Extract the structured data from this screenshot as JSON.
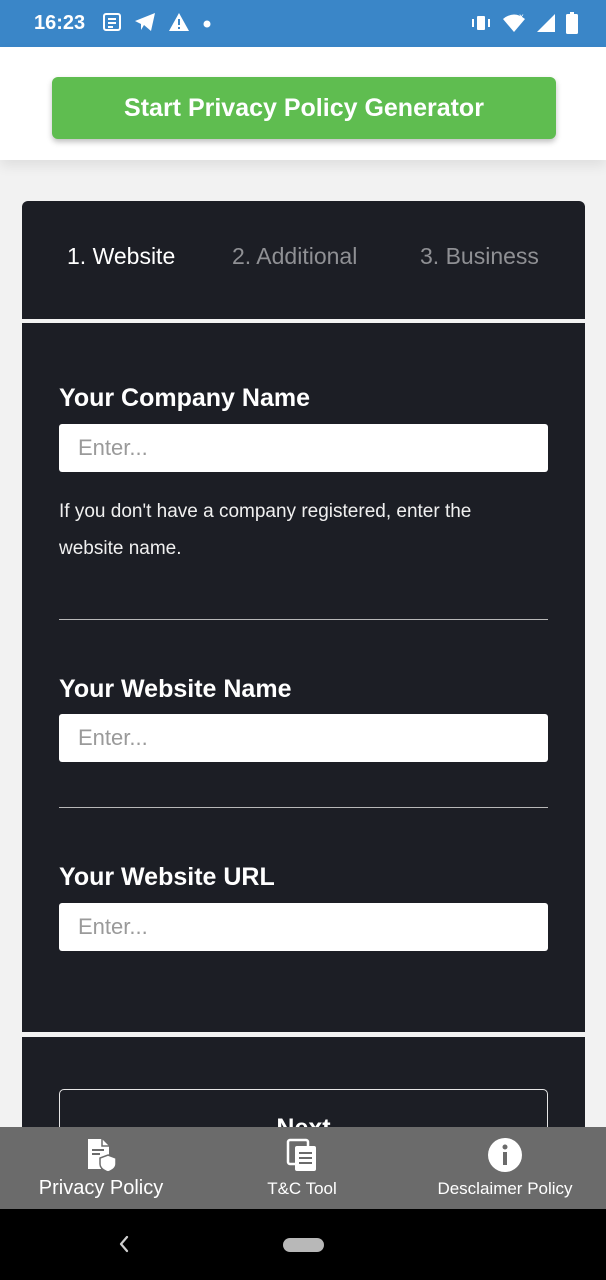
{
  "status_bar": {
    "time": "16:23",
    "left_icons": [
      "news-icon",
      "telegram-icon",
      "warning-icon",
      "dot-icon"
    ],
    "right_icons": [
      "vibrate-icon",
      "wifi-icon",
      "signal-icon",
      "battery-icon"
    ]
  },
  "header": {
    "start_button_label": "Start Privacy Policy Generator",
    "accent_color": "#5fbd50"
  },
  "tabs": [
    {
      "label": "1. Website",
      "active": true
    },
    {
      "label": "2. Additional",
      "active": false
    },
    {
      "label": "3. Business",
      "active": false
    }
  ],
  "form": {
    "company": {
      "label": "Your Company Name",
      "placeholder": "Enter...",
      "value": "",
      "hint": "If you don't have a company registered, enter the website name."
    },
    "website_name": {
      "label": "Your Website Name",
      "placeholder": "Enter...",
      "value": ""
    },
    "website_url": {
      "label": "Your Website URL",
      "placeholder": "Enter...",
      "value": ""
    },
    "next_label": "Next"
  },
  "bottom_nav": [
    {
      "label": "Privacy Policy",
      "icon": "privacy-document-icon"
    },
    {
      "label": "T&C Tool",
      "icon": "copy-document-icon"
    },
    {
      "label": "Desclaimer Policy",
      "icon": "info-icon"
    }
  ]
}
